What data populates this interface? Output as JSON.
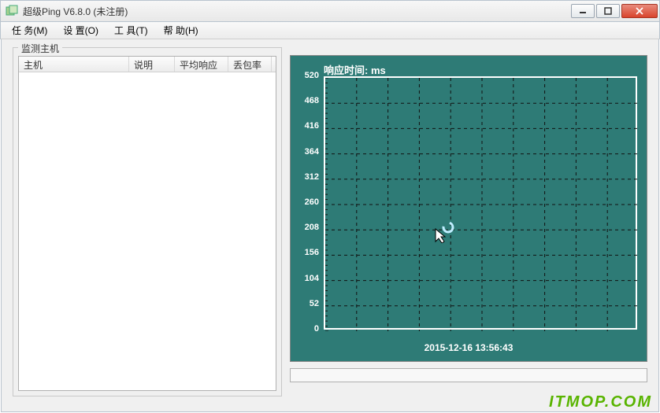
{
  "window": {
    "title": "超级Ping V6.8.0  (未注册)"
  },
  "menu": {
    "task": "任 务(M)",
    "settings": "设 置(O)",
    "tools": "工 具(T)",
    "help": "帮 助(H)"
  },
  "hosts_panel": {
    "legend": "监测主机",
    "columns": {
      "host": "主机",
      "desc": "说明",
      "avg": "平均响应",
      "loss": "丢包率"
    },
    "rows": []
  },
  "chart_data": {
    "type": "line",
    "title": "响应时间: ms",
    "xlabel": "2015-12-16  13:56:43",
    "ylabel": "",
    "ylim": [
      0,
      520
    ],
    "yticks": [
      0,
      52,
      104,
      156,
      208,
      260,
      312,
      364,
      416,
      468,
      520
    ],
    "series": [
      {
        "name": "响应时间",
        "values": []
      }
    ]
  },
  "watermark": "ITMOP.COM"
}
